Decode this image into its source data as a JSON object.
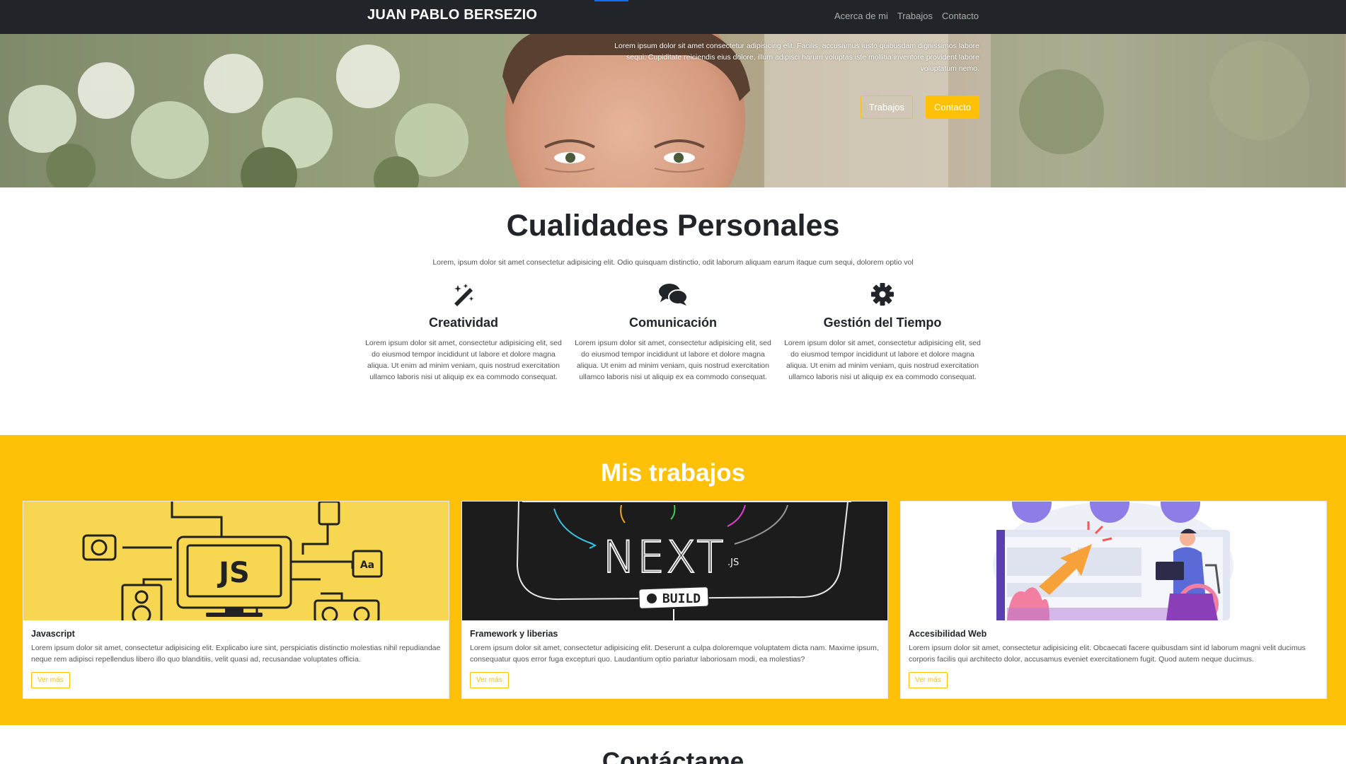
{
  "navbar": {
    "brand": "JUAN PABLO BERSEZIO",
    "links": [
      "Acerca de mi",
      "Trabajos",
      "Contacto"
    ],
    "active_indicator_color": "#0d6efd"
  },
  "hero": {
    "text": "Lorem ipsum dolor sit amet consectetur adipisicing elit. Facilis, accusamus iusto quibusdam dignissimos labore sequi. Cupiditate reiciendis eius dolore, illum adipisci harum voluptas iste mollitia inventore provident labore voluptatum nemo.",
    "buttons": [
      "Trabajos",
      "Contacto"
    ]
  },
  "qualities": {
    "title": "Cualidades Personales",
    "subtitle": "Lorem, ipsum dolor sit amet consectetur adipisicing elit. Odio quisquam distinctio, odit laborum aliquam earum itaque cum sequi, dolorem optio vol",
    "items": [
      {
        "icon": "magic-wand-icon",
        "title": "Creatividad",
        "text": "Lorem ipsum dolor sit amet, consectetur adipisicing elit, sed do eiusmod tempor incididunt ut labore et dolore magna aliqua. Ut enim ad minim veniam, quis nostrud exercitation ullamco laboris nisi ut aliquip ex ea commodo consequat."
      },
      {
        "icon": "comments-icon",
        "title": "Comunicación",
        "text": "Lorem ipsum dolor sit amet, consectetur adipisicing elit, sed do eiusmod tempor incididunt ut labore et dolore magna aliqua. Ut enim ad minim veniam, quis nostrud exercitation ullamco laboris nisi ut aliquip ex ea commodo consequat."
      },
      {
        "icon": "gear-icon",
        "title": "Gestión del Tiempo",
        "text": "Lorem ipsum dolor sit amet, consectetur adipisicing elit, sed do eiusmod tempor incididunt ut labore et dolore magna aliqua. Ut enim ad minim veniam, quis nostrud exercitation ullamco laboris nisi ut aliquip ex ea commodo consequat."
      }
    ]
  },
  "works": {
    "title": "Mis trabajos",
    "accent_color": "#ffc107",
    "cards": [
      {
        "title": "Javascript",
        "text": "Lorem ipsum dolor sit amet, consectetur adipisicing elit. Explicabo iure sint, perspiciatis distinctio molestias nihil repudiandae neque rem adipisci repellendus libero illo quo blanditiis, velit quasi ad, recusandae voluptates officia.",
        "button": "Ver más",
        "image_labels": [
          "JS",
          "Aa"
        ]
      },
      {
        "title": "Framework y liberias",
        "text": "Lorem ipsum dolor sit amet, consectetur adipisicing elit. Deserunt a culpa doloremque voluptatem dicta nam. Maxime ipsum, consequatur quos error fuga excepturi quo. Laudantium optio pariatur laboriosam modi, ea molestias?",
        "button": "Ver más",
        "image_labels": [
          "NEXT",
          ".JS",
          "BUILD"
        ]
      },
      {
        "title": "Accesibilidad Web",
        "text": "Lorem ipsum dolor sit amet, consectetur adipisicing elit. Obcaecati facere quibusdam sint id laborum magni velit ducimus corporis facilis qui architecto dolor, accusamus eveniet exercitationem fugit. Quod autem neque ducimus.",
        "button": "Ver más",
        "image_labels": []
      }
    ]
  },
  "contact": {
    "title": "Contáctame"
  }
}
